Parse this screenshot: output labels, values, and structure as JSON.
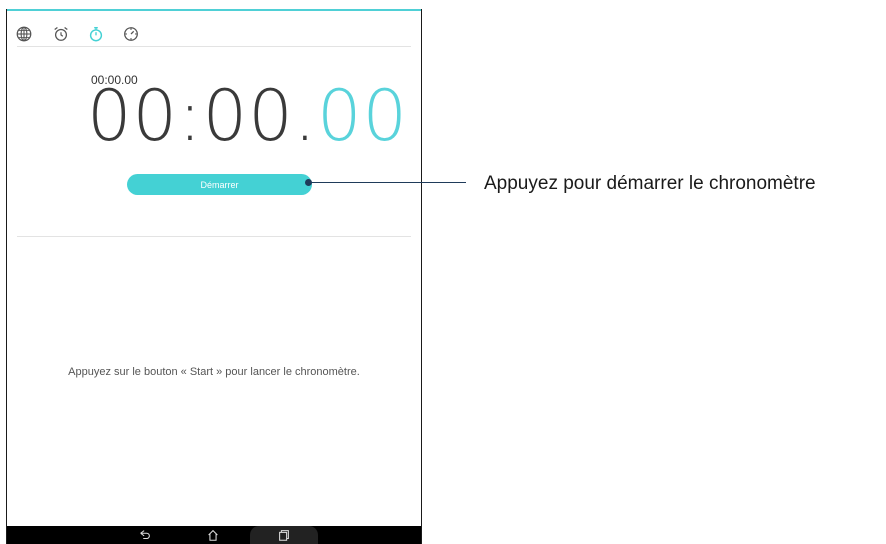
{
  "tabs": [
    {
      "icon": "globe-icon",
      "active": false
    },
    {
      "icon": "alarm-clock-icon",
      "active": false
    },
    {
      "icon": "stopwatch-icon",
      "active": true
    },
    {
      "icon": "timer-icon",
      "active": false
    }
  ],
  "stopwatch": {
    "lap_time": "00:00.00",
    "main_time": "00:00.",
    "fraction": "00"
  },
  "start_button": {
    "label": "Démarrer"
  },
  "hint": "Appuyez sur le bouton « Start » pour lancer le chronomètre.",
  "callout": {
    "text": "Appuyez pour démarrer le chronomètre"
  },
  "colors": {
    "accent": "#44d1d4",
    "callout": "#1f3b5a"
  },
  "navbar": {
    "buttons": [
      "back-icon",
      "home-icon",
      "recent-apps-icon"
    ]
  }
}
